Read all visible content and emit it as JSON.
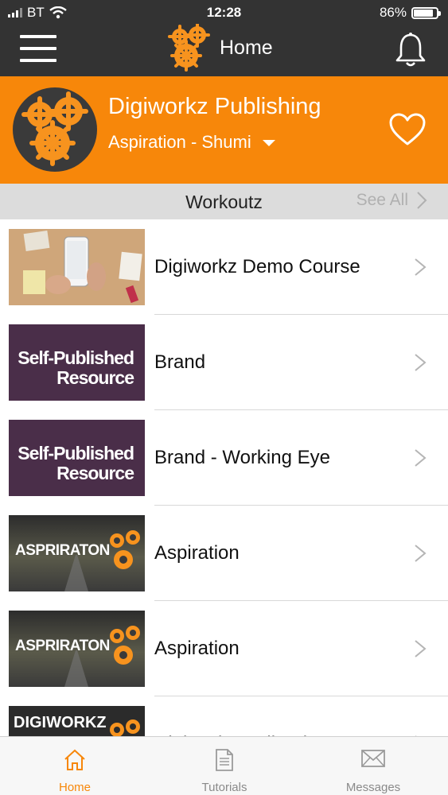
{
  "status_bar": {
    "carrier": "BT",
    "time": "12:28",
    "battery": "86%"
  },
  "nav": {
    "title": "Home",
    "menu_icon": "hamburger-menu-icon",
    "notification_icon": "bell-icon"
  },
  "banner": {
    "title": "Digiworkz Publishing",
    "subtitle": "Aspiration - Shumi",
    "favorite_icon": "heart-icon"
  },
  "section": {
    "title": "Workoutz",
    "see_all": "See All"
  },
  "courses": [
    {
      "title": "Digiworkz Demo Course",
      "thumb": "desk-photo"
    },
    {
      "title": "Brand",
      "thumb": "self-published",
      "thumb_text_1": "Self-Published",
      "thumb_text_2": "Resource"
    },
    {
      "title": "Brand - Working Eye",
      "thumb": "self-published",
      "thumb_text_1": "Self-Published",
      "thumb_text_2": "Resource"
    },
    {
      "title": "Aspiration",
      "thumb": "aspiraton",
      "thumb_text": "ASPRIRATON"
    },
    {
      "title": "Aspiration",
      "thumb": "aspiraton",
      "thumb_text": "ASPRIRATON"
    },
    {
      "title": "Digiworkz Daily Planner",
      "thumb": "digiworkz-daily",
      "thumb_text": "DIGIWORKZ"
    }
  ],
  "tabs": [
    {
      "label": "Home",
      "icon": "home-icon",
      "active": true
    },
    {
      "label": "Tutorials",
      "icon": "document-icon",
      "active": false
    },
    {
      "label": "Messages",
      "icon": "envelope-icon",
      "active": false
    }
  ],
  "colors": {
    "accent": "#f7870a",
    "topbar": "#333333",
    "section_bar": "#dcdcdc"
  }
}
